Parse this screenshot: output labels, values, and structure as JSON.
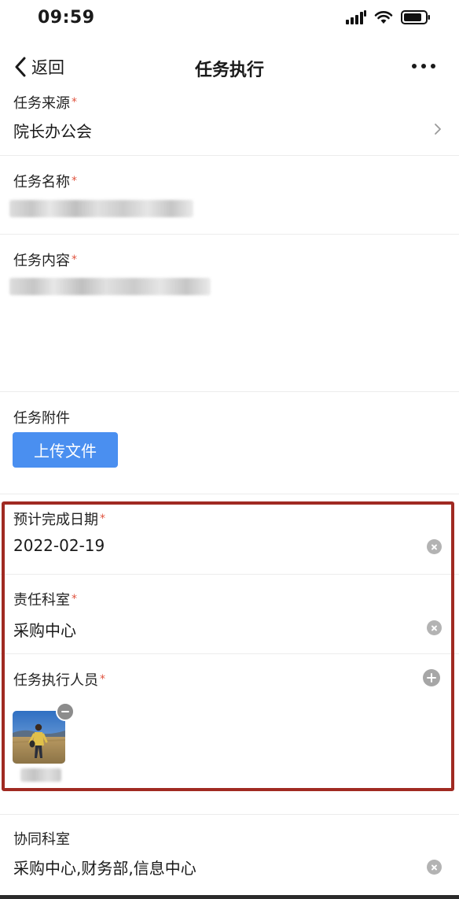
{
  "status_bar": {
    "time": "09:59"
  },
  "nav": {
    "back_label": "返回",
    "title": "任务执行"
  },
  "form": {
    "source": {
      "label": "任务来源",
      "required_mark": "*",
      "value": "院长办公会"
    },
    "name": {
      "label": "任务名称",
      "required_mark": "*"
    },
    "content": {
      "label": "任务内容",
      "required_mark": "*"
    },
    "attachment": {
      "label": "任务附件",
      "upload_label": "上传文件"
    },
    "due_date": {
      "label": "预计完成日期",
      "required_mark": "*",
      "value": "2022-02-19"
    },
    "department": {
      "label": "责任科室",
      "required_mark": "*",
      "value": "采购中心"
    },
    "executors": {
      "label": "任务执行人员",
      "required_mark": "*"
    },
    "cooperating": {
      "label": "协同科室",
      "value": "采购中心,财务部,信息中心"
    }
  },
  "colors": {
    "accent": "#4a8ff0",
    "required": "#e0543f",
    "highlight": "#a02a22"
  }
}
